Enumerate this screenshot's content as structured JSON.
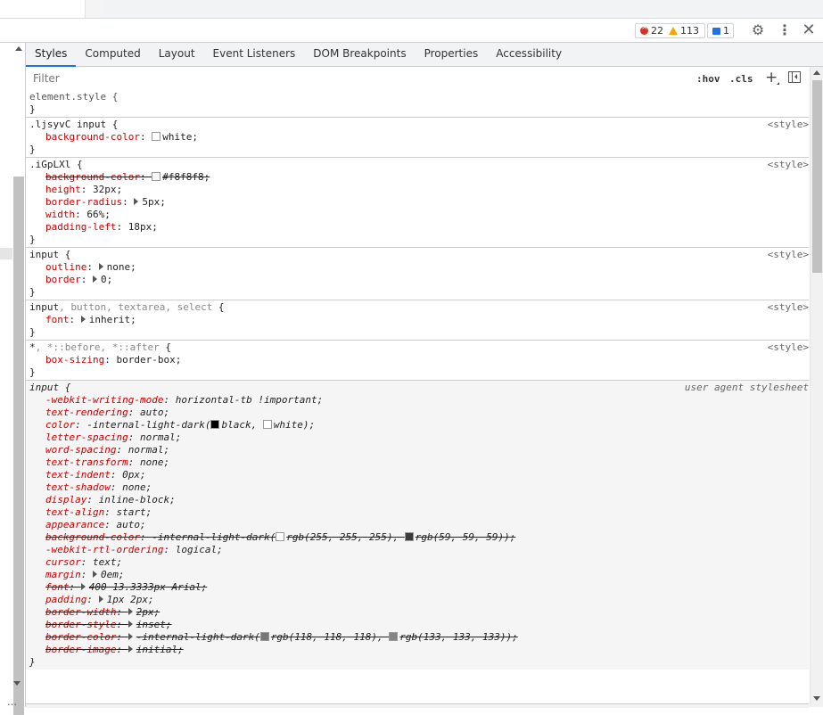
{
  "issues": {
    "errors": "22",
    "warnings": "113",
    "messages": "1"
  },
  "icons": {
    "settings": "gear-icon",
    "more": "kebab-icon",
    "close": "close-icon",
    "toggle_sidebar": "sidebar-toggle-icon",
    "new_rule": "plus-icon"
  },
  "tabs": [
    {
      "label": "Styles",
      "active": true
    },
    {
      "label": "Computed"
    },
    {
      "label": "Layout"
    },
    {
      "label": "Event Listeners"
    },
    {
      "label": "DOM Breakpoints"
    },
    {
      "label": "Properties"
    },
    {
      "label": "Accessibility"
    }
  ],
  "filter": {
    "placeholder": "Filter",
    "hov": ":hov",
    "cls": ".cls",
    "plus": "+"
  },
  "rules": {
    "element_style": {
      "selector": "element.style {",
      "close": "}"
    },
    "r1": {
      "selector": ".ljsyvC input",
      "open": " {",
      "origin": "<style>",
      "decls": [
        {
          "prop": "background-color",
          "value": "white"
        }
      ]
    },
    "r2": {
      "selector": ".iGpLXl",
      "open": " {",
      "origin": "<style>",
      "decls": [
        {
          "prop": "background-color",
          "value": "#f8f8f8"
        },
        {
          "prop": "height",
          "value": "32px"
        },
        {
          "prop": "border-radius",
          "value": "5px"
        },
        {
          "prop": "width",
          "value": "66%"
        },
        {
          "prop": "padding-left",
          "value": "18px"
        }
      ]
    },
    "r3": {
      "selector": "input",
      "open": " {",
      "origin": "<style>",
      "decls": [
        {
          "prop": "outline",
          "value": "none"
        },
        {
          "prop": "border",
          "value": "0"
        }
      ]
    },
    "r4": {
      "selector_main": "input",
      "selector_rest": ", button, textarea, select",
      "open": " {",
      "origin": "<style>",
      "decls": [
        {
          "prop": "font",
          "value": "inherit"
        }
      ]
    },
    "r5": {
      "selector_main": "*",
      "selector_rest": ", *::before, *::after",
      "open": " {",
      "origin": "<style>",
      "decls": [
        {
          "prop": "box-sizing",
          "value": "border-box"
        }
      ]
    },
    "ua": {
      "selector": "input",
      "open": " {",
      "origin": "user agent stylesheet",
      "decls": [
        {
          "prop": "-webkit-writing-mode",
          "value": "horizontal-tb !important"
        },
        {
          "prop": "text-rendering",
          "value": "auto"
        },
        {
          "prop": "color",
          "v1": "-internal-light-dark(",
          "v2": "black, ",
          "v3": "white)"
        },
        {
          "prop": "letter-spacing",
          "value": "normal"
        },
        {
          "prop": "word-spacing",
          "value": "normal"
        },
        {
          "prop": "text-transform",
          "value": "none"
        },
        {
          "prop": "text-indent",
          "value": "0px"
        },
        {
          "prop": "text-shadow",
          "value": "none"
        },
        {
          "prop": "display",
          "value": "inline-block"
        },
        {
          "prop": "text-align",
          "value": "start"
        },
        {
          "prop": "appearance",
          "value": "auto"
        },
        {
          "prop": "background-color",
          "v1": "-internal-light-dark(",
          "v2": "rgb(255, 255, 255), ",
          "v3": "rgb(59, 59, 59))"
        },
        {
          "prop": "-webkit-rtl-ordering",
          "value": "logical"
        },
        {
          "prop": "cursor",
          "value": "text"
        },
        {
          "prop": "margin",
          "value": "0em"
        },
        {
          "prop": "font",
          "value": "400 13.3333px Arial"
        },
        {
          "prop": "padding",
          "value": "1px 2px"
        },
        {
          "prop": "border-width",
          "value": "2px"
        },
        {
          "prop": "border-style",
          "value": "inset"
        },
        {
          "prop": "border-color",
          "v1": "-internal-light-dark(",
          "v2": "rgb(118, 118, 118), ",
          "v3": "rgb(133, 133, 133))"
        },
        {
          "prop": "border-image",
          "value": "initial"
        }
      ]
    }
  },
  "colors": {
    "accent": "#1a73e8",
    "prop": "#c80000",
    "white": "#ffffff",
    "f8": "#f8f8f8",
    "black": "#000000",
    "dark": "#3b3b3b",
    "gray118": "#767676",
    "gray133": "#858585"
  }
}
